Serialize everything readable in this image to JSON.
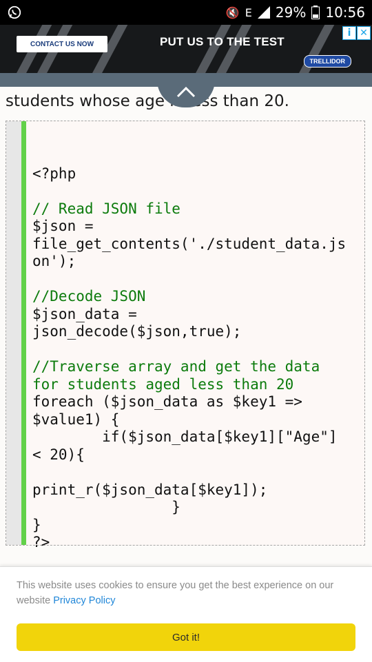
{
  "status": {
    "battery": "29%",
    "time": "10:56",
    "lte": "E"
  },
  "ad": {
    "contact": "CONTACT US NOW",
    "headline": "PUT US TO THE TEST",
    "brand": "TRELLIDOR",
    "info_icon": "info-icon",
    "close_icon": "close-icon"
  },
  "article": {
    "intro": "students whose age is less than 20."
  },
  "code": {
    "lines": [
      "",
      "<?php",
      "",
      "// Read JSON file",
      "$json =",
      "file_get_contents('./student_data.js",
      "on');",
      "",
      "//Decode JSON",
      "$json_data =",
      "json_decode($json,true);",
      "",
      "//Traverse array and get the data",
      "for students aged less than 20",
      "foreach ($json_data as $key1 =>",
      "$value1) {",
      "        if($json_data[$key1][\"Age\"]",
      "< 20){",
      "",
      "print_r($json_data[$key1]);",
      "                }",
      "}",
      "?>"
    ]
  },
  "cookie": {
    "text": "This website uses cookies to ensure you get the best experience on our website ",
    "link": "Privacy Policy",
    "button": "Got it!"
  },
  "colors": {
    "accent_green": "#62d14a",
    "comment_green": "#0c7b0c",
    "button_yellow": "#f1d40b"
  }
}
